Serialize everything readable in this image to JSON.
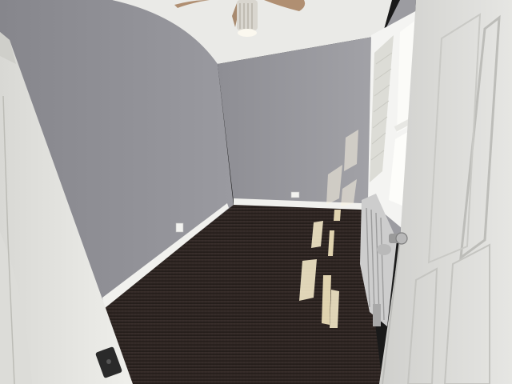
{
  "scene": {
    "description_free": true,
    "colors": {
      "wall_left": "#8f8f95",
      "wall_back": "#97979c",
      "ceiling": "#e9e9e6",
      "carpet": "#2e2522",
      "baseboard": "#f1f1ee",
      "door": "#d9d9d6",
      "door_frame_left": "#e4e4e0",
      "window_frame": "#f4f4f2",
      "sunlight": "#fff7d9",
      "radiator": "#cfcfcf",
      "fan_blade": "#b08f72",
      "fan_light": "#f7f3e6"
    },
    "icons": [
      "ceiling-fan-icon",
      "door-knob-icon",
      "latch-plate-icon",
      "electrical-outlet-icon"
    ]
  }
}
